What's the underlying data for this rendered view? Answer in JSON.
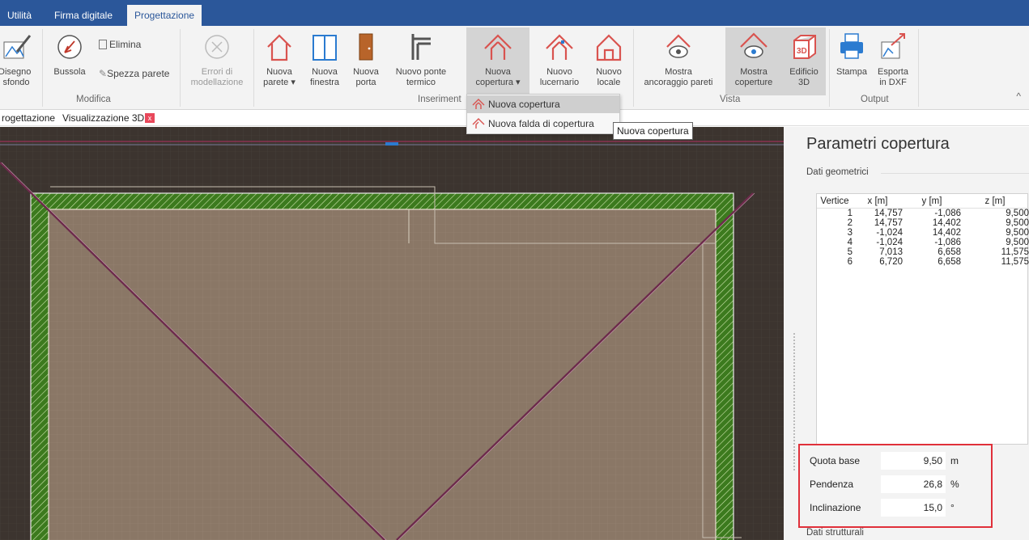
{
  "menu": {
    "tabs": [
      "Utilità",
      "Firma digitale",
      "Progettazione"
    ]
  },
  "ribbon": {
    "disegno_label": "Disegno\ni sfondo",
    "bussola": "Bussola",
    "elimina": "Elimina",
    "spezza_parete": "Spezza parete",
    "errori": "Errori di\nmodellazione",
    "nuova_parete": "Nuova\nparete ▾",
    "nuova_finestra": "Nuova\nfinestra",
    "nuova_porta": "Nuova\nporta",
    "nuovo_ponte": "Nuovo ponte\ntermico",
    "nuova_copertura": "Nuova\ncopertura ▾",
    "nuovo_lucernario": "Nuovo\nlucernario",
    "nuovo_locale": "Nuovo\nlocale",
    "mostra_ancoraggio": "Mostra\nancoraggio pareti",
    "mostra_coperture": "Mostra\ncoperture",
    "edificio_3d": "Edificio\n3D",
    "stampa": "Stampa",
    "esporta_dxf": "Esporta\nin DXF",
    "groups": {
      "modifica": "Modifica",
      "inserimento": "Inseriment",
      "vista": "Vista",
      "output": "Output"
    },
    "collapse_glyph": "^"
  },
  "doctabs": {
    "progettazione": "rogettazione",
    "visualizzazione": "Visualizzazione 3D",
    "close_glyph": "x"
  },
  "dropdown": {
    "items": [
      "Nuova copertura",
      "Nuova falda di copertura"
    ],
    "tooltip": "Nuova copertura"
  },
  "panel": {
    "title": "Parametri copertura",
    "dati_geometrici": "Dati geometrici",
    "table": {
      "headers": [
        "Vertice",
        "x [m]",
        "y [m]",
        "z [m]"
      ],
      "rows": [
        [
          "1",
          "14,757",
          "-1,086",
          "9,500"
        ],
        [
          "2",
          "14,757",
          "14,402",
          "9,500"
        ],
        [
          "3",
          "-1,024",
          "14,402",
          "9,500"
        ],
        [
          "4",
          "-1,024",
          "-1,086",
          "9,500"
        ],
        [
          "5",
          "7,013",
          "6,658",
          "11,575"
        ],
        [
          "6",
          "6,720",
          "6,658",
          "11,575"
        ]
      ]
    },
    "quota_base": {
      "label": "Quota base",
      "value": "9,50",
      "unit": "m"
    },
    "pendenza": {
      "label": "Pendenza",
      "value": "26,8",
      "unit": "%"
    },
    "inclinazione": {
      "label": "Inclinazione",
      "value": "15,0",
      "unit": "°"
    },
    "dati_strutturali": "Dati strutturali"
  },
  "colors": {
    "menubar": "#2b579a",
    "accent_red": "#e0303a",
    "hatch_green": "#3c7a1e",
    "roof_fill": "#8a7766",
    "canvas_bg": "#3c342f"
  }
}
